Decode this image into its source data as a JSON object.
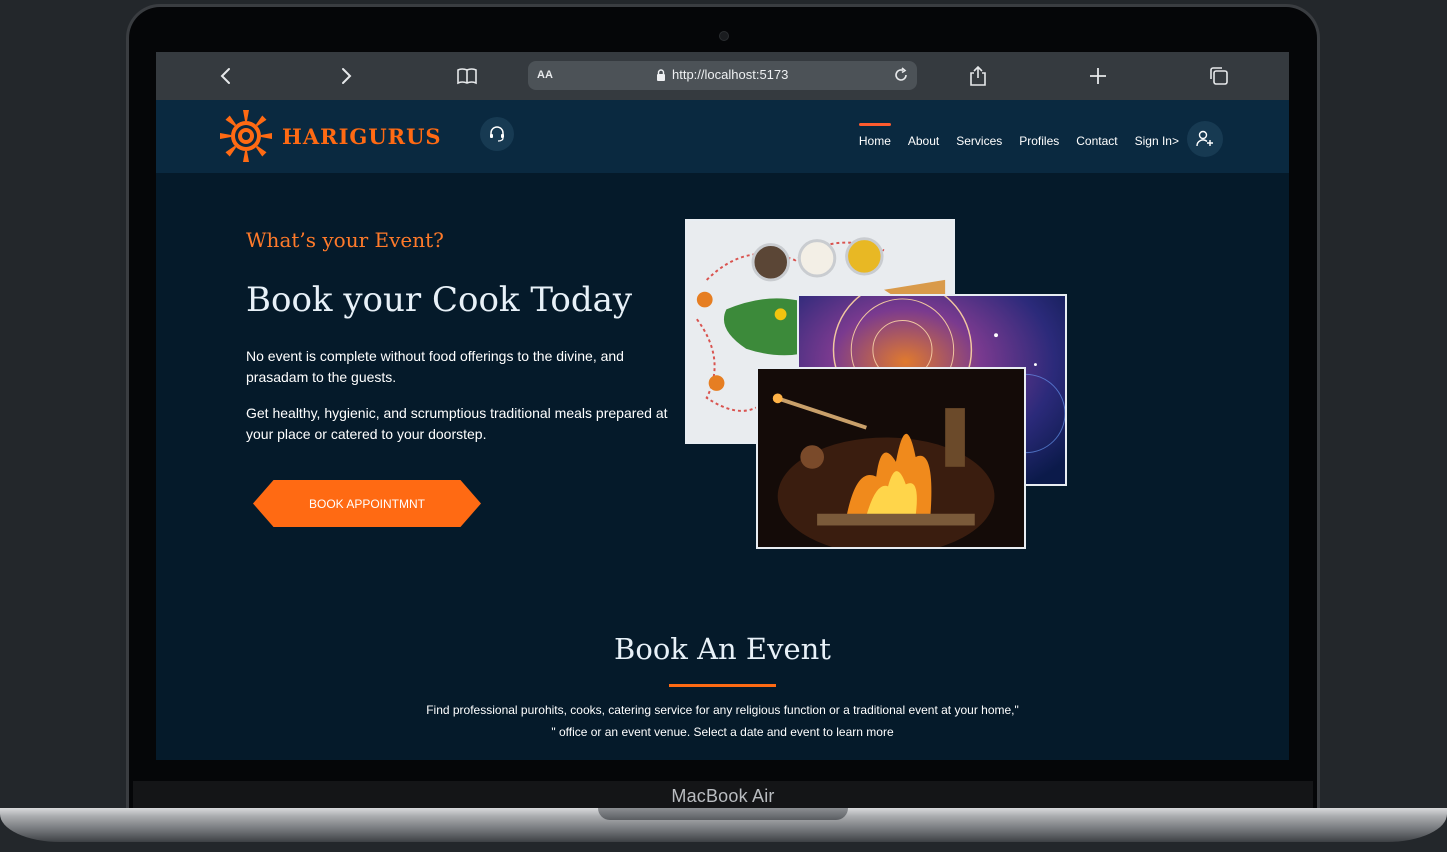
{
  "browser": {
    "text_size_label": "AA",
    "url": "http://localhost:5173"
  },
  "site": {
    "brand": "HARIGURUS",
    "nav": [
      "Home",
      "About",
      "Services",
      "Profiles",
      "Contact",
      "Sign In>"
    ],
    "active_nav": "Home"
  },
  "hero": {
    "eyebrow": "What’s your Event?",
    "headline": "Book your Cook Today",
    "para1": "No event is complete without food offerings to the divine, and prasadam to the guests.",
    "para2": "Get healthy, hygienic, and scrumptious traditional meals prepared at your place or catered to your doorstep.",
    "cta": "BOOK APPOINTMNT"
  },
  "section": {
    "title": "Book An Event",
    "desc_line1": "Find professional purohits, cooks, catering service for any religious function or a traditional event at your home,\"",
    "desc_line2": "\" office or an event venue. Select a date and event to learn more"
  },
  "device": {
    "label": "MacBook Air"
  },
  "colors": {
    "accent": "#ff6a13",
    "page_bg": "#051a2a",
    "nav_bg": "#0a2940"
  }
}
